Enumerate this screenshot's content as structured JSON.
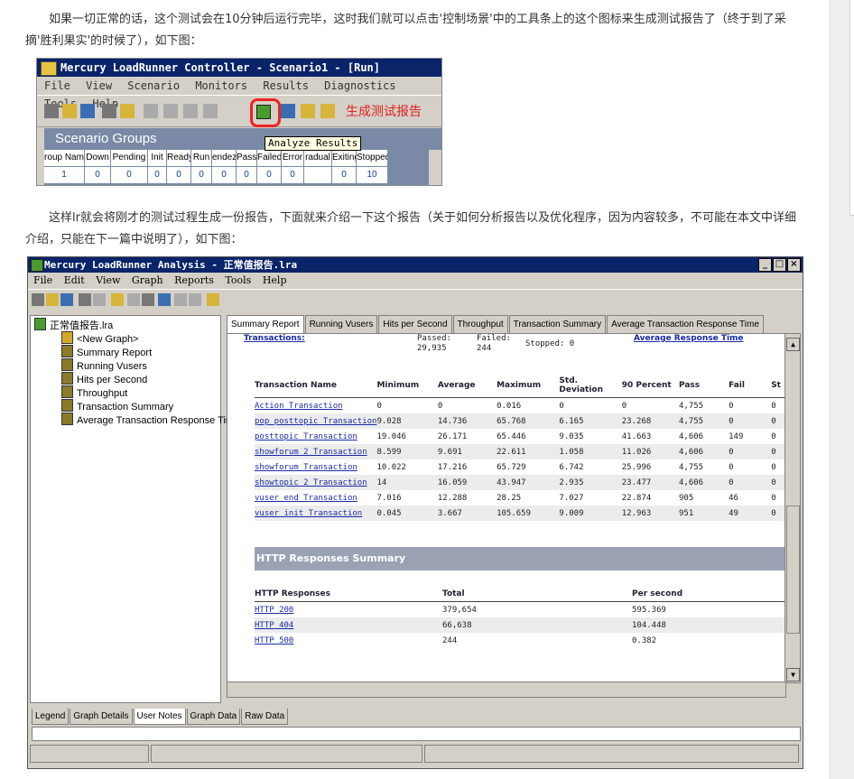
{
  "paragraph1": "如果一切正常的话，这个测试会在10分钟后运行完毕，这时我们就可以点击'控制场景'中的工具条上的这个图标来生成测试报告了（终于到了采摘'胜利果实'的时候了），如下图：",
  "paragraph2": "这样lr就会将刚才的测试过程生成一份报告，下面就来介绍一下这个报告（关于如何分析报告以及优化程序，因为内容较多，不可能在本文中详细介绍，只能在下一篇中说明了），如下图：",
  "controller": {
    "title": "Mercury LoadRunner Controller - Scenario1 - [Run]",
    "menu": [
      "File",
      "View",
      "Scenario",
      "Monitors",
      "Results",
      "Diagnostics",
      "Tools",
      "Help"
    ],
    "annotation": "生成测试报告",
    "tooltip": "Analyze Results",
    "scenario_groups_title": "Scenario Groups",
    "columns": [
      "roup Nam",
      "Down",
      "Pending",
      "Init",
      "Ready",
      "Run",
      "endez",
      "Passed",
      "Failed",
      "Error",
      "radual",
      "Exiting",
      "Stopped"
    ],
    "values": [
      "1",
      "0",
      "0",
      "0",
      "0",
      "0",
      "0",
      "0",
      "0",
      "0",
      "",
      "0",
      "10"
    ]
  },
  "analysis": {
    "title": "Mercury LoadRunner Analysis - 正常值报告.lra",
    "menu": [
      "File",
      "Edit",
      "View",
      "Graph",
      "Reports",
      "Tools",
      "Help"
    ],
    "tree": {
      "root": "正常值报告.lra",
      "items": [
        "<New Graph>",
        "Summary Report",
        "Running Vusers",
        "Hits per Second",
        "Throughput",
        "Transaction Summary",
        "Average Transaction Response Time"
      ]
    },
    "tabs": [
      "Summary Report",
      "Running Vusers",
      "Hits per Second",
      "Throughput",
      "Transaction Summary",
      "Average Transaction Response Time"
    ],
    "report": {
      "top_link": "Transactions:",
      "top_passed": "Passed: 29,935",
      "top_failed": "Failed: 244",
      "top_stopped": "Stopped: 0",
      "top_link2": "Average Response Time",
      "trans_headers": [
        "Transaction Name",
        "Minimum",
        "Average",
        "Maximum",
        "Std. Deviation",
        "90 Percent",
        "Pass",
        "Fail",
        "St"
      ],
      "trans_rows": [
        [
          "Action_Transaction",
          "0",
          "0",
          "0.016",
          "0",
          "0",
          "4,755",
          "0",
          "0"
        ],
        [
          "pop_posttopic_Transaction",
          "9.028",
          "14.736",
          "65.768",
          "6.165",
          "23.268",
          "4,755",
          "0",
          "0"
        ],
        [
          "posttopic_Transaction",
          "19.046",
          "26.171",
          "65.446",
          "9.035",
          "41.663",
          "4,606",
          "149",
          "0"
        ],
        [
          "showforum_2_Transaction",
          "8.599",
          "9.691",
          "22.611",
          "1.058",
          "11.026",
          "4,606",
          "0",
          "0"
        ],
        [
          "showforum_Transaction",
          "10.022",
          "17.216",
          "65.729",
          "6.742",
          "25.996",
          "4,755",
          "0",
          "0"
        ],
        [
          "showtopic_2_Transaction",
          "14",
          "16.059",
          "43.947",
          "2.935",
          "23.477",
          "4,606",
          "0",
          "0"
        ],
        [
          "vuser_end_Transaction",
          "7.016",
          "12.288",
          "28.25",
          "7.027",
          "22.874",
          "905",
          "46",
          "0"
        ],
        [
          "vuser_init_Transaction",
          "0.045",
          "3.667",
          "105.659",
          "9.009",
          "12.963",
          "951",
          "49",
          "0"
        ]
      ],
      "http_title": "HTTP Responses Summary",
      "http_headers": [
        "HTTP Responses",
        "Total",
        "Per second"
      ],
      "http_rows": [
        [
          "HTTP_200",
          "379,654",
          "595.369"
        ],
        [
          "HTTP_404",
          "66,638",
          "104.448"
        ],
        [
          "HTTP_500",
          "244",
          "0.382"
        ]
      ]
    },
    "bottom_tabs": [
      "Legend",
      "Graph Details",
      "User Notes",
      "Graph Data",
      "Raw Data"
    ]
  }
}
